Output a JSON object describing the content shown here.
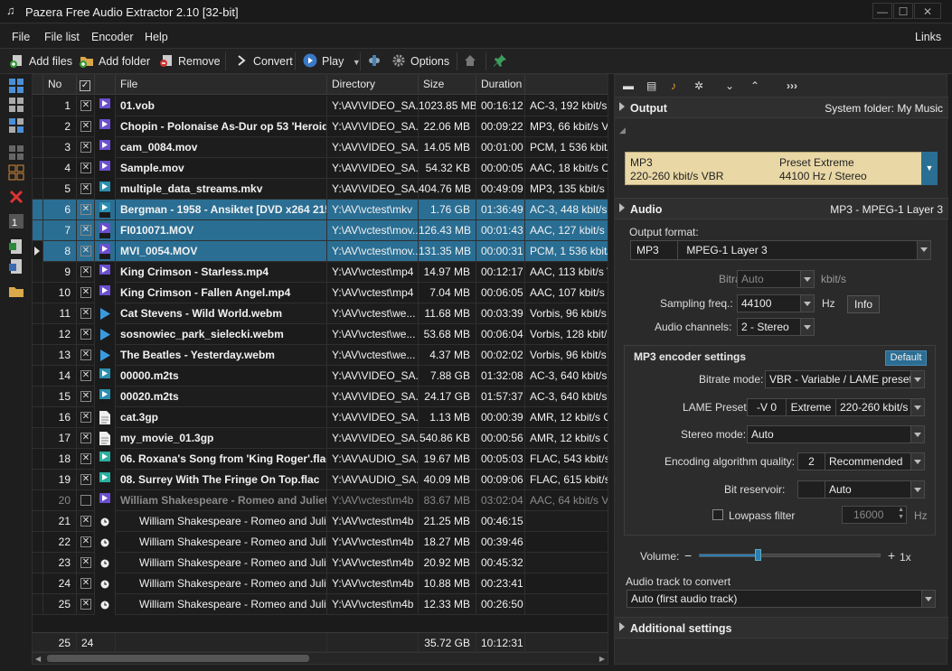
{
  "window": {
    "title": "Pazera Free Audio Extractor 2.10  [32-bit]"
  },
  "menu": {
    "file": "File",
    "filelist": "File list",
    "encoder": "Encoder",
    "help": "Help",
    "links": "Links"
  },
  "toolbar": {
    "add_files": "Add files",
    "add_folder": "Add folder",
    "remove": "Remove",
    "convert": "Convert",
    "play": "Play",
    "options": "Options"
  },
  "columns": {
    "no": "No",
    "file": "File",
    "directory": "Directory",
    "size": "Size",
    "duration": "Duration"
  },
  "rows": [
    {
      "no": "1",
      "checked": true,
      "icon": "VOB",
      "file": "01.vob",
      "dir": "Y:\\AV\\VIDEO_SA...",
      "size": "1023.85 MB",
      "dur": "00:16:12",
      "info": "AC-3, 192 kbit/s",
      "bold": true
    },
    {
      "no": "2",
      "checked": true,
      "icon": "FLV",
      "file": "Chopin - Polonaise As-Dur op 53 'Heroiqu...",
      "dir": "Y:\\AV\\VIDEO_SA...",
      "size": "22.06 MB",
      "dur": "00:09:22",
      "info": "MP3, 66 kbit/s VE",
      "bold": true
    },
    {
      "no": "3",
      "checked": true,
      "icon": "MOV",
      "file": "cam_0084.mov",
      "dir": "Y:\\AV\\VIDEO_SA...",
      "size": "14.05 MB",
      "dur": "00:01:00",
      "info": "PCM, 1 536 kbit/s",
      "bold": true
    },
    {
      "no": "4",
      "checked": true,
      "icon": "MOV",
      "file": "Sample.mov",
      "dir": "Y:\\AV\\VIDEO_SA...",
      "size": "54.32 KB",
      "dur": "00:00:05",
      "info": "AAC, 18 kbit/s CE",
      "bold": true
    },
    {
      "no": "5",
      "checked": true,
      "icon": "MKV",
      "file": "multiple_data_streams.mkv",
      "dir": "Y:\\AV\\VIDEO_SA...",
      "size": "404.76 MB",
      "dur": "00:49:09",
      "info": "MP3, 135 kbit/s V",
      "bold": true
    },
    {
      "no": "6",
      "checked": true,
      "icon": "MKV",
      "file": "Bergman - 1958 - Ansiktet [DVD x264 2152...",
      "dir": "Y:\\AV\\vctest\\mkv",
      "size": "1.76 GB",
      "dur": "01:36:49",
      "info": "AC-3, 448 kbit/s C",
      "bold": true,
      "sel": true
    },
    {
      "no": "7",
      "checked": true,
      "icon": "MOV",
      "file": "FI010071.MOV",
      "dir": "Y:\\AV\\vctest\\mov...",
      "size": "126.43 MB",
      "dur": "00:01:43",
      "info": "AAC, 127 kbit/s Vi",
      "bold": true,
      "sel": true
    },
    {
      "no": "8",
      "checked": true,
      "icon": "MOV",
      "file": "MVI_0054.MOV",
      "dir": "Y:\\AV\\vctest\\mov...",
      "size": "131.35 MB",
      "dur": "00:00:31",
      "info": "PCM, 1 536 kbit/s",
      "bold": true,
      "sel": true,
      "current": true
    },
    {
      "no": "9",
      "checked": true,
      "icon": "MP4",
      "file": "King Crimson - Starless.mp4",
      "dir": "Y:\\AV\\vctest\\mp4",
      "size": "14.97 MB",
      "dur": "00:12:17",
      "info": "AAC, 113 kbit/s V",
      "bold": true
    },
    {
      "no": "10",
      "checked": true,
      "icon": "MP4",
      "file": "King Crimson - Fallen Angel.mp4",
      "dir": "Y:\\AV\\vctest\\mp4",
      "size": "7.04 MB",
      "dur": "00:06:05",
      "info": "AAC, 107 kbit/s V",
      "bold": true
    },
    {
      "no": "11",
      "checked": true,
      "icon": "PLAY",
      "file": "Cat Stevens - Wild World.webm",
      "dir": "Y:\\AV\\vctest\\we...",
      "size": "11.68 MB",
      "dur": "00:03:39",
      "info": "Vorbis, 96 kbit/s",
      "bold": true
    },
    {
      "no": "12",
      "checked": true,
      "icon": "PLAY",
      "file": "sosnowiec_park_sielecki.webm",
      "dir": "Y:\\AV\\vctest\\we...",
      "size": "53.68 MB",
      "dur": "00:06:04",
      "info": "Vorbis, 128 kbit/s",
      "bold": true
    },
    {
      "no": "13",
      "checked": true,
      "icon": "PLAY",
      "file": "The Beatles - Yesterday.webm",
      "dir": "Y:\\AV\\vctest\\we...",
      "size": "4.37 MB",
      "dur": "00:02:02",
      "info": "Vorbis, 96 kbit/s",
      "bold": true
    },
    {
      "no": "14",
      "checked": true,
      "icon": "M2T",
      "file": "00000.m2ts",
      "dir": "Y:\\AV\\VIDEO_SA...",
      "size": "7.88 GB",
      "dur": "01:32:08",
      "info": "AC-3, 640 kbit/s",
      "bold": true
    },
    {
      "no": "15",
      "checked": true,
      "icon": "M2T",
      "file": "00020.m2ts",
      "dir": "Y:\\AV\\VIDEO_SA...",
      "size": "24.17 GB",
      "dur": "01:57:37",
      "info": "AC-3, 640 kbit/s",
      "bold": true
    },
    {
      "no": "16",
      "checked": true,
      "icon": "DOC",
      "file": "cat.3gp",
      "dir": "Y:\\AV\\VIDEO_SA...",
      "size": "1.13 MB",
      "dur": "00:00:39",
      "info": "AMR, 12 kbit/s Cl",
      "bold": true
    },
    {
      "no": "17",
      "checked": true,
      "icon": "DOC",
      "file": "my_movie_01.3gp",
      "dir": "Y:\\AV\\VIDEO_SA...",
      "size": "540.86 KB",
      "dur": "00:00:56",
      "info": "AMR, 12 kbit/s Cl",
      "bold": true
    },
    {
      "no": "18",
      "checked": true,
      "icon": "FLAC",
      "file": "06. Roxana's Song from 'King Roger'.flac",
      "dir": "Y:\\AV\\AUDIO_SA...",
      "size": "19.67 MB",
      "dur": "00:05:03",
      "info": "FLAC, 543 kbit/s V",
      "bold": true
    },
    {
      "no": "19",
      "checked": true,
      "icon": "FLAC",
      "file": "08. Surrey With The Fringe On Top.flac",
      "dir": "Y:\\AV\\AUDIO_SA...",
      "size": "40.09 MB",
      "dur": "00:09:06",
      "info": "FLAC, 615 kbit/s V",
      "bold": true
    },
    {
      "no": "20",
      "checked": false,
      "icon": "M4B",
      "file": "William Shakespeare - Romeo and Juliet....",
      "dir": "Y:\\AV\\vctest\\m4b",
      "size": "83.67 MB",
      "dur": "03:02:04",
      "info": "AAC, 64 kbit/s VE",
      "bold": true,
      "gray": true
    },
    {
      "no": "21",
      "checked": true,
      "icon": "CLOCK",
      "file": "William Shakespeare - Romeo and Juli...",
      "dir": "Y:\\AV\\vctest\\m4b",
      "size": "21.25 MB",
      "dur": "00:46:15",
      "info": "",
      "indent": true
    },
    {
      "no": "22",
      "checked": true,
      "icon": "CLOCK",
      "file": "William Shakespeare - Romeo and Juli...",
      "dir": "Y:\\AV\\vctest\\m4b",
      "size": "18.27 MB",
      "dur": "00:39:46",
      "info": "",
      "indent": true
    },
    {
      "no": "23",
      "checked": true,
      "icon": "CLOCK",
      "file": "William Shakespeare - Romeo and Juli...",
      "dir": "Y:\\AV\\vctest\\m4b",
      "size": "20.92 MB",
      "dur": "00:45:32",
      "info": "",
      "indent": true
    },
    {
      "no": "24",
      "checked": true,
      "icon": "CLOCK",
      "file": "William Shakespeare - Romeo and Juli...",
      "dir": "Y:\\AV\\vctest\\m4b",
      "size": "10.88 MB",
      "dur": "00:23:41",
      "info": "",
      "indent": true
    },
    {
      "no": "25",
      "checked": true,
      "icon": "CLOCK",
      "file": "William Shakespeare - Romeo and Juli...",
      "dir": "Y:\\AV\\vctest\\m4b",
      "size": "12.33 MB",
      "dur": "00:26:50",
      "info": "",
      "indent": true
    }
  ],
  "footer": {
    "count": "25",
    "checked": "24",
    "total_size": "35.72 GB",
    "total_duration": "10:12:31"
  },
  "output": {
    "title": "Output",
    "system_folder": "System folder: My Music",
    "preset_l1": "MP3",
    "preset_l2": "220-260 kbit/s VBR",
    "preset_r1": "Preset Extreme",
    "preset_r2": "44100 Hz / Stereo"
  },
  "audio": {
    "title": "Audio",
    "format_desc": "MP3 - MPEG-1 Layer 3",
    "output_format_label": "Output format:",
    "output_format_code": "MP3",
    "output_format_value": "MPEG-1 Layer 3",
    "bitrate_label": "Bitrate:",
    "bitrate_value": "Auto",
    "bitrate_unit": "kbit/s",
    "sampling_label": "Sampling freq.:",
    "sampling_value": "44100",
    "sampling_unit": "Hz",
    "info_button": "Info",
    "channels_label": "Audio channels:",
    "channels_value": "2 - Stereo"
  },
  "mp3": {
    "title": "MP3 encoder settings",
    "default_button": "Default",
    "bitrate_mode_label": "Bitrate mode:",
    "bitrate_mode_value": "VBR - Variable / LAME preset",
    "lame_label": "LAME Preset:",
    "lame_switch": "-V 0",
    "lame_name": "Extreme",
    "lame_value": "220-260 kbit/s",
    "stereo_label": "Stereo mode:",
    "stereo_value": "Auto",
    "quality_label": "Encoding algorithm quality:",
    "quality_num": "2",
    "quality_value": "Recommended",
    "reservoir_label": "Bit reservoir:",
    "reservoir_value": "Auto",
    "lowpass_label": "Lowpass filter",
    "lowpass_value": "16000",
    "lowpass_unit": "Hz"
  },
  "volume": {
    "label": "Volume:",
    "value": "1x",
    "level": 0.32
  },
  "track": {
    "label": "Audio track to convert",
    "value": "Auto (first audio track)"
  },
  "additional": {
    "title": "Additional settings"
  },
  "colors": {
    "accent": "#2a6e93",
    "preset_bg": "#e9d8a6",
    "purple_icon": "#6b4fcf",
    "teal_icon": "#2ab0a0"
  }
}
